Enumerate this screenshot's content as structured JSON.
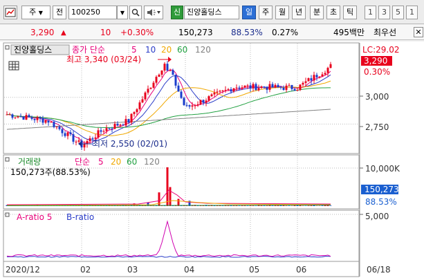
{
  "toolbar": {
    "type_select": "주",
    "mode_label": "전",
    "stock_code": "100250",
    "credit_badge": "신",
    "stock_name": "진양홀딩스",
    "periods": [
      "일",
      "주",
      "월",
      "년",
      "분",
      "초",
      "틱"
    ],
    "active_period": "일",
    "intervals": [
      "1",
      "3",
      "5",
      "1"
    ],
    "colors": {
      "active": "#2c6fd6",
      "credit": "#2f9b3a"
    }
  },
  "quote": {
    "price": "3,290",
    "change": "10",
    "change_pct": "+0.30%",
    "volume": "150,273",
    "volume_ratio": "88.53%",
    "turnover": "0.27%",
    "trade_amount": "495백만",
    "best_quote_label": "최우선"
  },
  "price_panel": {
    "stock_name": "진양홀딩스",
    "ma_title": "종가 단순",
    "ma_periods": [
      "5",
      "10",
      "20",
      "60",
      "120"
    ],
    "ma_colors": [
      "#e8007a",
      "#2a3cc8",
      "#f0a800",
      "#20a040",
      "#808080"
    ],
    "high_label": "최고 3,340 (03/24)",
    "low_label": "최저 2,550 (02/01)",
    "lc_label": "LC:29.02",
    "last_price": "3,290",
    "last_change": "0.30%",
    "y_ticks": [
      "3,000",
      "2,750"
    ]
  },
  "volume_panel": {
    "title": "거래량",
    "ma_title": "단순",
    "ma_periods": [
      "5",
      "20",
      "60",
      "120"
    ],
    "value_text": "150,273주(88.53%)",
    "y_tick": "10,000K",
    "last_volume": "150,273",
    "last_ratio": "88.53%"
  },
  "ratio_panel": {
    "a_label": "A-ratio 5",
    "b_label": "B-ratio",
    "y_tick": "5,000"
  },
  "x_axis": {
    "labels": [
      "2020/12",
      "02",
      "03",
      "04",
      "05",
      "06"
    ],
    "end_date": "06/18"
  },
  "chart_data": {
    "type": "candlestick",
    "period": "daily",
    "series": [
      {
        "name": "price",
        "ylim": [
          2550,
          3340
        ],
        "keypoints": [
          {
            "x": "2020/12",
            "y": 2840
          },
          {
            "x": "01",
            "y": 2780
          },
          {
            "x": "02/01",
            "y": 2550
          },
          {
            "x": "02",
            "y": 2700
          },
          {
            "x": "03",
            "y": 2780
          },
          {
            "x": "03/24",
            "y": 3340
          },
          {
            "x": "04",
            "y": 2900
          },
          {
            "x": "05",
            "y": 3100
          },
          {
            "x": "06",
            "y": 3090
          },
          {
            "x": "06/18",
            "y": 3290
          }
        ]
      },
      {
        "name": "volume",
        "ylim": [
          0,
          10000
        ],
        "keypoints": [
          {
            "x": "03/24",
            "y": 10200
          },
          {
            "x": "04",
            "y": 1900
          },
          {
            "x": "06/18",
            "y": 150
          }
        ]
      },
      {
        "name": "A-ratio",
        "ylim": [
          0,
          5000
        ],
        "keypoints": [
          {
            "x": "2020/12",
            "y": 250
          },
          {
            "x": "03/24",
            "y": 4200
          },
          {
            "x": "06/18",
            "y": 500
          }
        ]
      }
    ]
  }
}
